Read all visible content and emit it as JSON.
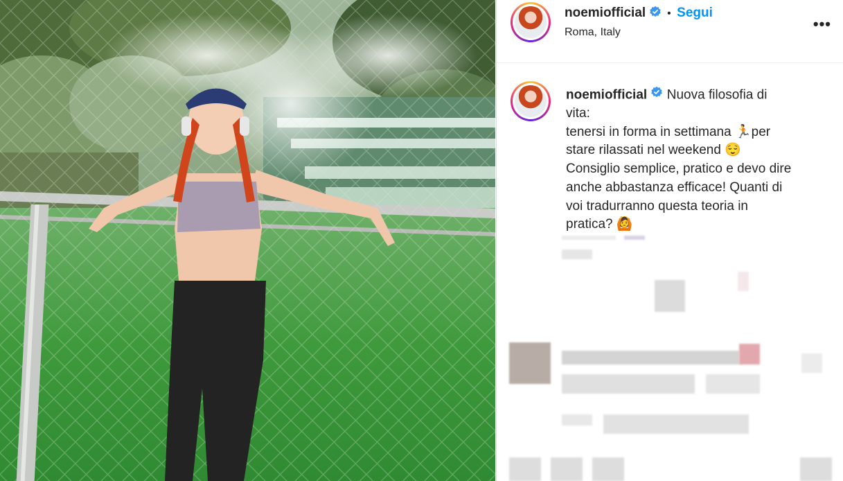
{
  "post": {
    "username": "noemiofficial",
    "follow_separator": "•",
    "follow_label": "Segui",
    "location": "Roma, Italy",
    "more_icon": "more-options-icon"
  },
  "caption": {
    "username": "noemiofficial",
    "line1": "Nuova filosofia di",
    "line2": "vita:",
    "line3": "tenersi in forma in settimana",
    "emoji1": "🏃",
    "line3b": "per",
    "line4": "stare rilassati nel weekend",
    "emoji2": "😌",
    "line5": "Consiglio semplice, pratico e devo dire",
    "line6": "anche abbastanza efficace! Quanti di",
    "line7": "voi tradurranno questa teoria in",
    "line8": "pratica?",
    "emoji3": "🙆"
  },
  "colors": {
    "accent": "#0095f6",
    "text": "#262626",
    "water": "#3f9a3c"
  }
}
